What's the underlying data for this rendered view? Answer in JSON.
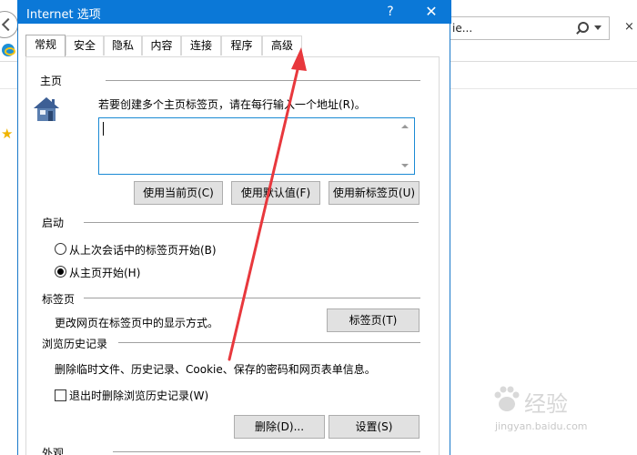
{
  "browser": {
    "address_text": "ie...",
    "close_glyph": "×",
    "icons": [
      "back-icon",
      "ie-logo-icon",
      "search-icon",
      "dropdown-icon",
      "favorites-star-icon"
    ]
  },
  "dialog": {
    "title": "Internet 选项",
    "help_glyph": "?",
    "close_glyph": "✕",
    "tabs": [
      "常规",
      "安全",
      "隐私",
      "内容",
      "连接",
      "程序",
      "高级"
    ],
    "active_tab": "常规",
    "homepage": {
      "title": "主页",
      "instruction": "若要创建多个主页标签页，请在每行输入一个地址(R)。",
      "textarea_value": "",
      "buttons": {
        "use_current": "使用当前页(C)",
        "use_default": "使用默认值(F)",
        "use_new_tab": "使用新标签页(U)"
      }
    },
    "startup": {
      "title": "启动",
      "options": [
        {
          "label": "从上次会话中的标签页开始(B)",
          "checked": false
        },
        {
          "label": "从主页开始(H)",
          "checked": true
        }
      ]
    },
    "tabs_section": {
      "title": "标签页",
      "description": "更改网页在标签页中的显示方式。",
      "button": "标签页(T)"
    },
    "history": {
      "title": "浏览历史记录",
      "description": "删除临时文件、历史记录、Cookie、保存的密码和网页表单信息。",
      "checkbox_label": "退出时删除浏览历史记录(W)",
      "checkbox_checked": false,
      "delete_button": "删除(D)...",
      "settings_button": "设置(S)"
    },
    "appearance": {
      "title": "外观"
    }
  },
  "annotation": {
    "arrow_color": "#e8383d"
  },
  "watermark": {
    "brand": "经验",
    "url": "jingyan.baidu.com"
  },
  "colors": {
    "titlebar": "#0b78d7",
    "dialog_border": "#1979ca",
    "button_face": "#e1e1e1",
    "button_border": "#adadad",
    "input_focus_border": "#1a8ad4"
  }
}
